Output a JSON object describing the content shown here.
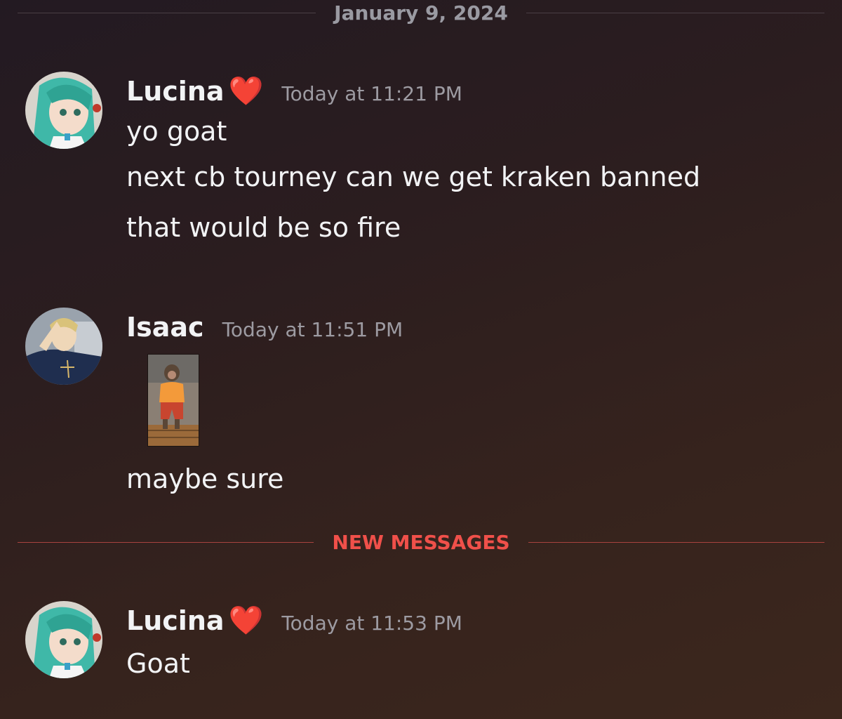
{
  "date_divider": {
    "label": "January 9, 2024"
  },
  "new_messages_divider": {
    "label": "NEW MESSAGES"
  },
  "messages": [
    {
      "username": "Lucina",
      "badge": "❤️",
      "timestamp": "Today at 11:21 PM",
      "lines": [
        "yo goat",
        "next cb tourney can we get kraken banned",
        "that would be so fire"
      ]
    },
    {
      "username": "Isaac",
      "timestamp": "Today at 11:51 PM",
      "attachment": "monkey-image",
      "lines": [
        "maybe sure"
      ]
    },
    {
      "username": "Lucina",
      "badge": "❤️",
      "timestamp": "Today at 11:53 PM",
      "lines": [
        "Goat"
      ]
    }
  ],
  "colors": {
    "accent_new_messages": "#f0504a",
    "heart": "#e8283a",
    "timestamp": "#9d9ba2"
  }
}
